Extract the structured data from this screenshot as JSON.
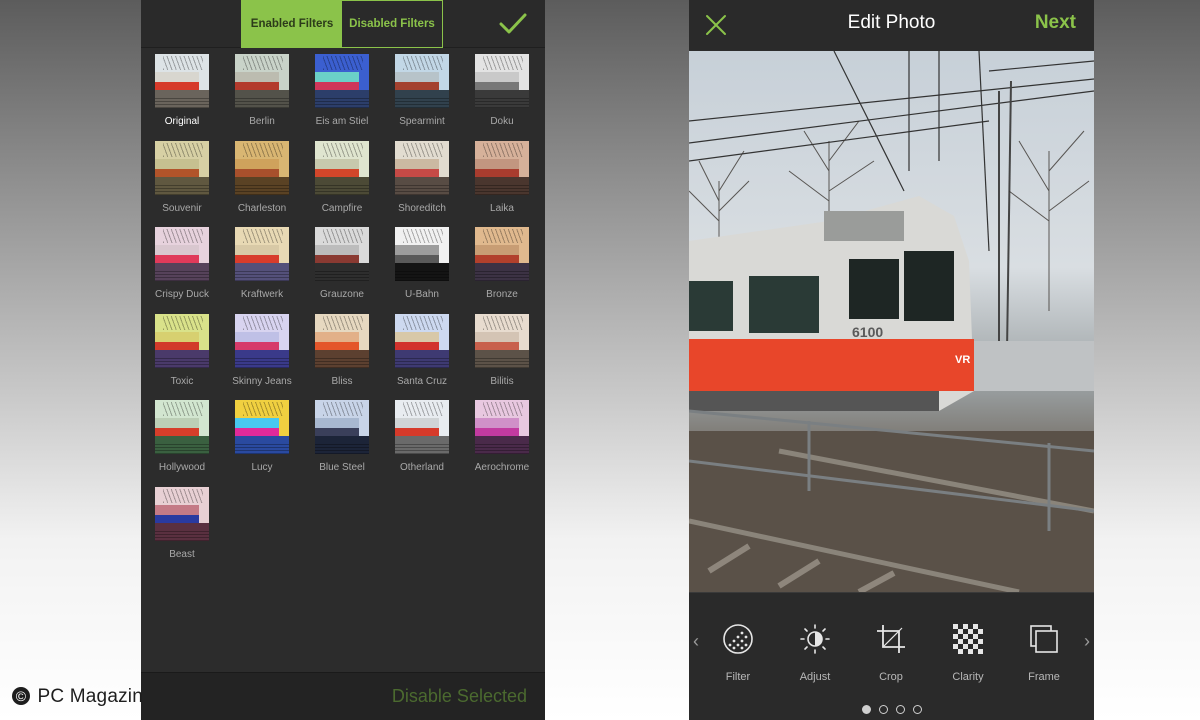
{
  "left_screen": {
    "tabs": [
      {
        "label": "Enabled Filters",
        "active": true
      },
      {
        "label": "Disabled Filters",
        "active": false
      }
    ],
    "confirm_icon": "checkmark-icon",
    "filters": [
      {
        "name": "Original",
        "selected": true,
        "palette": [
          "#dde3e6",
          "#d8d6cf",
          "#d63a2a",
          "#6a645c"
        ]
      },
      {
        "name": "Berlin",
        "selected": false,
        "palette": [
          "#c9d3c9",
          "#bcbcb0",
          "#b33a2c",
          "#53524a"
        ]
      },
      {
        "name": "Eis am Stiel",
        "selected": false,
        "palette": [
          "#3b5fd0",
          "#6bd0c8",
          "#d0365a",
          "#2c3e6a"
        ]
      },
      {
        "name": "Spearmint",
        "selected": false,
        "palette": [
          "#c2d7e6",
          "#b7c3c9",
          "#a4412f",
          "#31414d"
        ]
      },
      {
        "name": "Doku",
        "selected": false,
        "palette": [
          "#e3e3e3",
          "#c9c9c9",
          "#777777",
          "#3a3a3a"
        ]
      },
      {
        "name": "Souvenir",
        "selected": false,
        "palette": [
          "#d7d0a4",
          "#c6c090",
          "#b2542a",
          "#605840"
        ]
      },
      {
        "name": "Charleston",
        "selected": false,
        "palette": [
          "#d9b672",
          "#cfa25c",
          "#a8502c",
          "#5a4224"
        ]
      },
      {
        "name": "Campfire",
        "selected": false,
        "palette": [
          "#dfe5cf",
          "#c7c9ad",
          "#d2462a",
          "#4c4a36"
        ]
      },
      {
        "name": "Shoreditch",
        "selected": false,
        "palette": [
          "#e2dcd0",
          "#cbb9a2",
          "#c64a46",
          "#584c44"
        ]
      },
      {
        "name": "Laika",
        "selected": false,
        "palette": [
          "#d6b19a",
          "#c29680",
          "#a83c2e",
          "#4a362e"
        ]
      },
      {
        "name": "Crispy Duck",
        "selected": false,
        "palette": [
          "#e7d2dd",
          "#d9c7cf",
          "#e03a5a",
          "#56425a"
        ]
      },
      {
        "name": "Kraftwerk",
        "selected": false,
        "palette": [
          "#e8d9b4",
          "#d8c9a6",
          "#d83c2c",
          "#54507a"
        ]
      },
      {
        "name": "Grauzone",
        "selected": false,
        "palette": [
          "#dadada",
          "#bcbcbc",
          "#8a3a32",
          "#2e2e2e"
        ]
      },
      {
        "name": "U-Bahn",
        "selected": false,
        "palette": [
          "#f1f1f1",
          "#9d9d9d",
          "#5a5a5a",
          "#141414"
        ]
      },
      {
        "name": "Bronze",
        "selected": false,
        "palette": [
          "#e0b98e",
          "#c89d74",
          "#b2402c",
          "#3c3244"
        ]
      },
      {
        "name": "Toxic",
        "selected": false,
        "palette": [
          "#d9e28a",
          "#d7d070",
          "#d23a2a",
          "#4a3a6a"
        ]
      },
      {
        "name": "Skinny Jeans",
        "selected": false,
        "palette": [
          "#d8d4f0",
          "#bfc0e6",
          "#d63a6a",
          "#3a3a8a"
        ]
      },
      {
        "name": "Bliss",
        "selected": false,
        "palette": [
          "#e6d8c0",
          "#e2b088",
          "#e4562a",
          "#5c4030"
        ]
      },
      {
        "name": "Santa Cruz",
        "selected": false,
        "palette": [
          "#cdd9f0",
          "#d8c8a8",
          "#d2322c",
          "#3e3a72"
        ]
      },
      {
        "name": "Bilitis",
        "selected": false,
        "palette": [
          "#e8dccf",
          "#d4c4b4",
          "#c8604c",
          "#5c5248"
        ]
      },
      {
        "name": "Hollywood",
        "selected": false,
        "palette": [
          "#d2e6d0",
          "#bccfb6",
          "#d63e2a",
          "#3a6040"
        ]
      },
      {
        "name": "Lucy",
        "selected": false,
        "palette": [
          "#f0d040",
          "#48c8f0",
          "#e02a9a",
          "#2a4aa0"
        ]
      },
      {
        "name": "Blue Steel",
        "selected": false,
        "palette": [
          "#c8d4e8",
          "#a8b8d0",
          "#3a3f5a",
          "#1c2438"
        ]
      },
      {
        "name": "Otherland",
        "selected": false,
        "palette": [
          "#e8ecf0",
          "#d0d4d6",
          "#d63a2a",
          "#6a6a6a"
        ]
      },
      {
        "name": "Aerochrome",
        "selected": false,
        "palette": [
          "#e8c8e0",
          "#d090c8",
          "#c23aa0",
          "#4a2a4a"
        ]
      },
      {
        "name": "Beast",
        "selected": false,
        "palette": [
          "#e8d0d4",
          "#c47a86",
          "#2a3aa0",
          "#5a3040"
        ]
      }
    ],
    "bottom_action": "Disable Selected"
  },
  "watermark": {
    "text": "PC Magazin",
    "symbol": "©"
  },
  "right_screen": {
    "close_icon": "close-icon",
    "title": "Edit Photo",
    "next_label": "Next",
    "train_number": "6100",
    "train_logo": "VR",
    "tools": [
      {
        "label": "Filter",
        "icon": "filter-icon"
      },
      {
        "label": "Adjust",
        "icon": "brightness-icon"
      },
      {
        "label": "Crop",
        "icon": "crop-icon"
      },
      {
        "label": "Clarity",
        "icon": "clarity-icon"
      },
      {
        "label": "Frame",
        "icon": "frame-icon"
      }
    ],
    "page_indicator": {
      "count": 4,
      "active": 0
    }
  },
  "colors": {
    "accent": "#8bc34a",
    "background": "#2c2c2c"
  }
}
